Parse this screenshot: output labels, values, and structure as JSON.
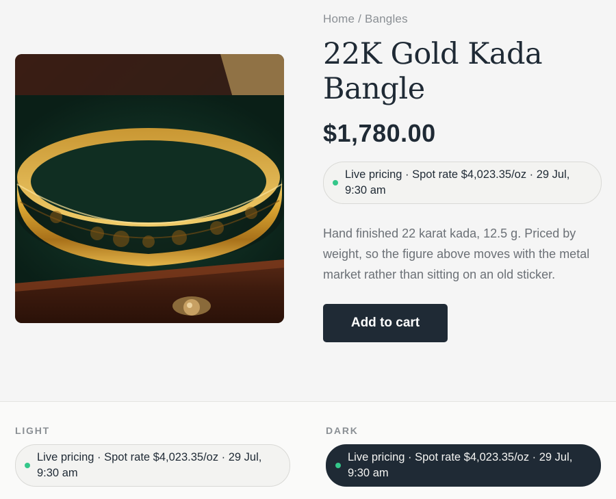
{
  "breadcrumb": {
    "home": "Home",
    "separator": " / ",
    "current": "Bangles"
  },
  "product": {
    "title": "22K Gold Kada Bangle",
    "price": "$1,780.00",
    "description": "Hand finished 22 karat kada, 12.5 g. Priced by weight, so the figure above moves with the metal market rather than sitting on an old sticker.",
    "image_alt": "22K gold kada bangle with engraved floral pattern on green velvet"
  },
  "pricing_badge": {
    "text": "Live pricing · Spot rate $4,023.35/oz · 29 Jul, 9:30 am",
    "status_color": "#34c78a"
  },
  "cart": {
    "add_label": "Add to cart"
  },
  "variants": {
    "light": {
      "label": "LIGHT",
      "text": "Live pricing · Spot rate $4,023.35/oz · 29 Jul, 9:30 am"
    },
    "dark": {
      "label": "DARK",
      "text": "Live pricing · Spot rate $4,023.35/oz · 29 Jul, 9:30 am"
    }
  },
  "colors": {
    "ink": "#1f2a35",
    "accent_live": "#34c78a",
    "muted": "#6b7076"
  }
}
